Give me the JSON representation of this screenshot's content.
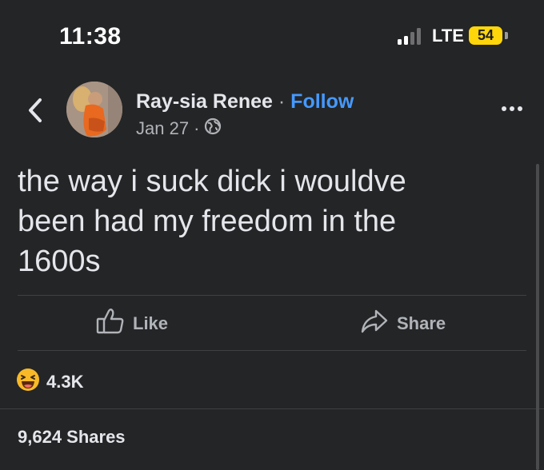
{
  "status_bar": {
    "time": "11:38",
    "network": "LTE",
    "battery": "54",
    "signal_bars_active": 2,
    "signal_bars_total": 4,
    "battery_color": "#ffd60a"
  },
  "header": {
    "back_icon": "chevron-left-icon",
    "author_name": "Ray-sia Renee",
    "separator": "·",
    "follow_label": "Follow",
    "date": "Jan 27",
    "meta_separator": "·",
    "privacy_icon": "globe-icon",
    "more_icon": "more-horizontal-icon"
  },
  "post": {
    "lines": [
      "the way i suck dick i wouldve",
      "been had my freedom in the",
      "1600s"
    ]
  },
  "actions": {
    "like_label": "Like",
    "like_icon": "thumbs-up-icon",
    "share_label": "Share",
    "share_icon": "share-arrow-icon"
  },
  "stats": {
    "reaction_icon": "laughing-emoji-icon",
    "reaction_count": "4.3K",
    "shares": "9,624 Shares"
  },
  "colors": {
    "background": "#242526",
    "text": "#e4e6eb",
    "secondary_text": "#b0b3b8",
    "follow_link": "#4599ff",
    "divider": "#3e4042",
    "emoji_yellow": "#f7b928"
  }
}
